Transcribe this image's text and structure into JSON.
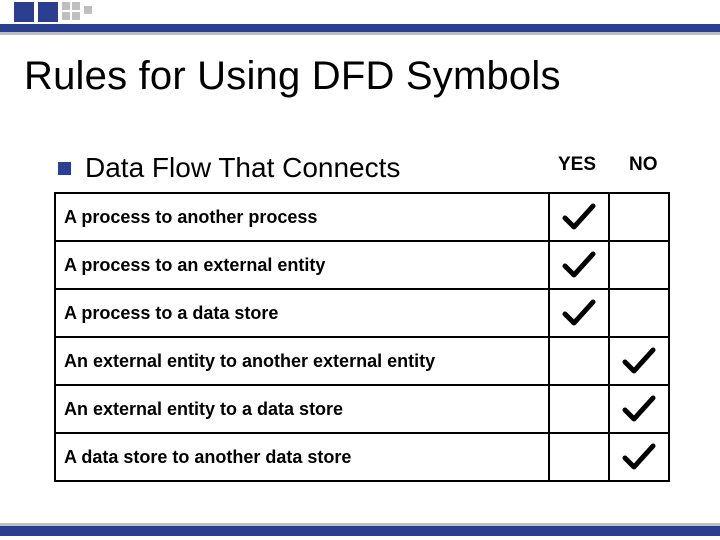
{
  "title": "Rules for Using DFD Symbols",
  "subhead": "Data Flow That Connects",
  "columns": {
    "yes": "YES",
    "no": "NO"
  },
  "chart_data": {
    "type": "table",
    "columns": [
      "Data Flow That Connects",
      "YES",
      "NO"
    ],
    "rows": [
      {
        "label": "A process to another process",
        "yes": true,
        "no": false
      },
      {
        "label": "A process to an external entity",
        "yes": true,
        "no": false
      },
      {
        "label": "A process to a data store",
        "yes": true,
        "no": false
      },
      {
        "label": "An external entity to another external entity",
        "yes": false,
        "no": true
      },
      {
        "label": "An external entity to a data store",
        "yes": false,
        "no": true
      },
      {
        "label": "A data store to another data store",
        "yes": false,
        "no": true
      }
    ]
  }
}
